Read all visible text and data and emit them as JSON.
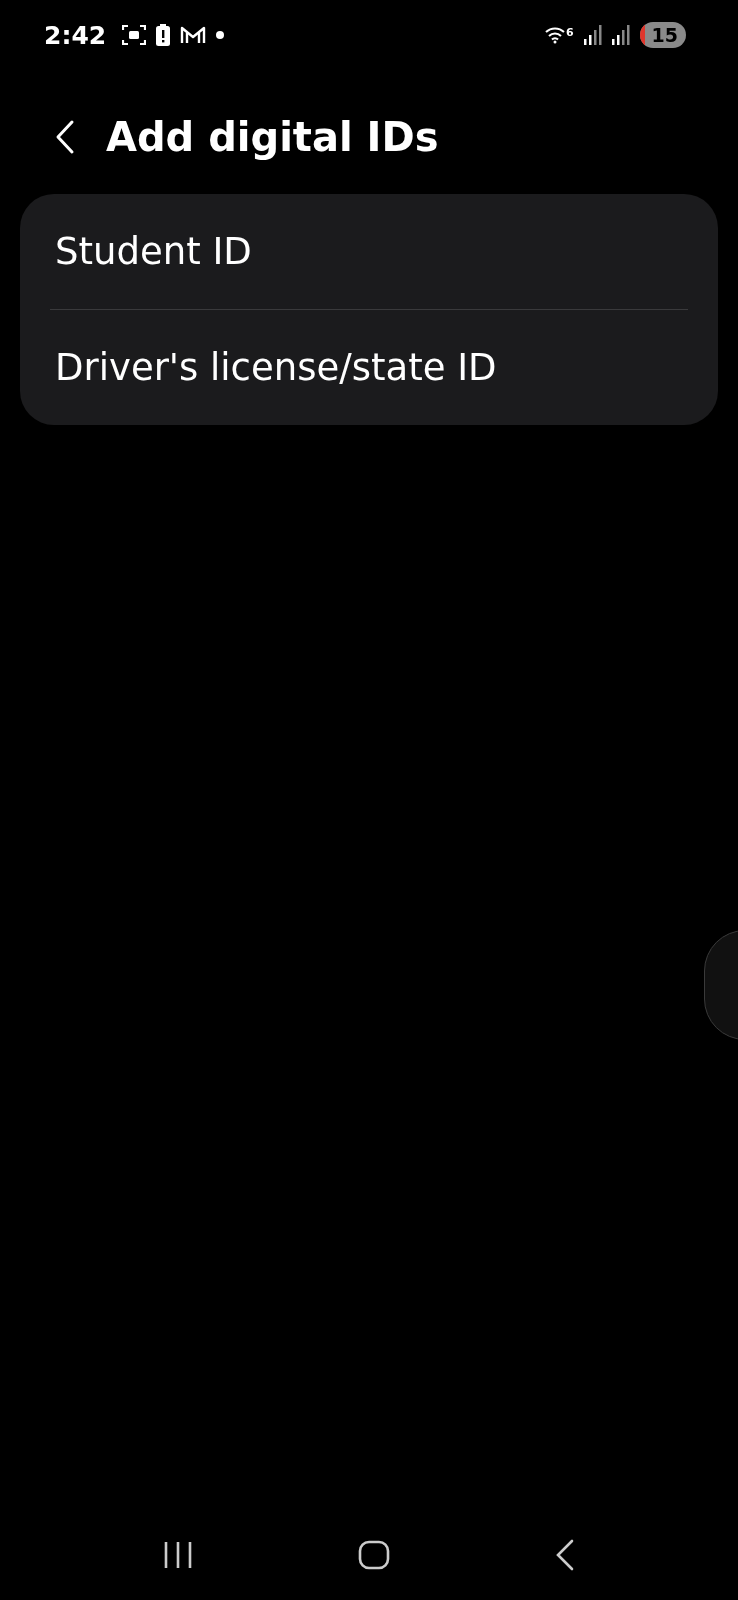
{
  "status_bar": {
    "time": "2:42",
    "wifi_badge": "6",
    "battery": "15"
  },
  "header": {
    "title": "Add digital IDs"
  },
  "list": {
    "items": [
      {
        "label": "Student ID"
      },
      {
        "label": "Driver's license/state ID"
      }
    ]
  }
}
